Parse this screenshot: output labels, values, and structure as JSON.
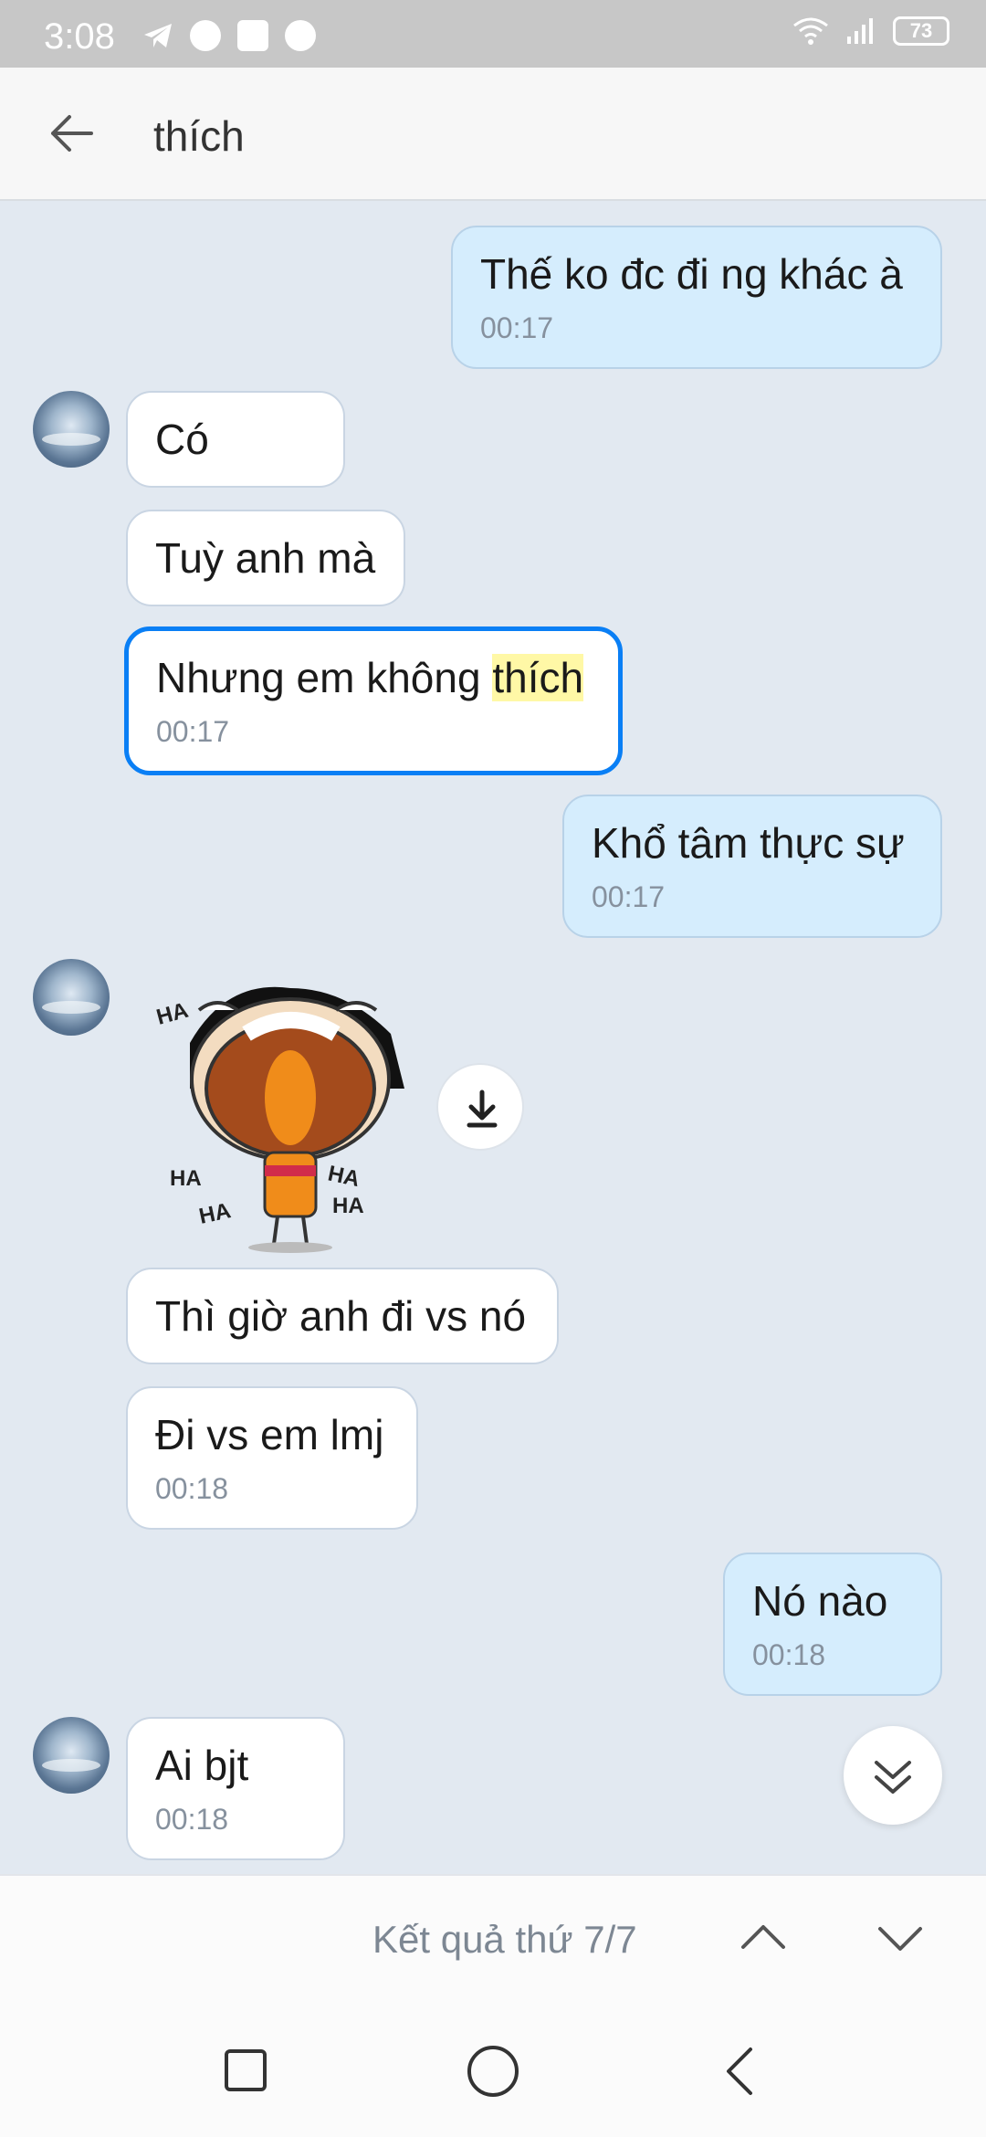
{
  "status_bar": {
    "time": "3:08",
    "battery": "73"
  },
  "header": {
    "title": "thích"
  },
  "messages": [
    {
      "text": "Thế ko đc đi ng khác à",
      "time": "00:17"
    },
    {
      "text": "Có"
    },
    {
      "text": "Tuỳ anh mà"
    },
    {
      "text_before": "Nhưng em không ",
      "text_highlight": "thích",
      "time": "00:17"
    },
    {
      "text": "Khổ tâm thực sự",
      "time": "00:17"
    },
    {
      "text": "Thì giờ anh đi vs nó"
    },
    {
      "text": "Đi vs em lmj",
      "time": "00:18"
    },
    {
      "text": "Nó nào",
      "time": "00:18"
    },
    {
      "text": "Ai bjt",
      "time": "00:18"
    }
  ],
  "sticker": {
    "ha_text": "HA"
  },
  "result_bar": {
    "text": "Kết quả thứ 7/7"
  },
  "icons": {
    "back": "arrow-left-icon",
    "download": "download-icon",
    "scroll_down": "double-chevron-down-icon",
    "up": "chevron-up-icon",
    "down": "chevron-down-icon"
  },
  "colors": {
    "background": "#e2e9f1",
    "outgoing_bubble": "#d5edfd",
    "incoming_bubble": "#ffffff",
    "highlight_border": "#0a7ff5",
    "search_highlight": "#fff8a6"
  }
}
